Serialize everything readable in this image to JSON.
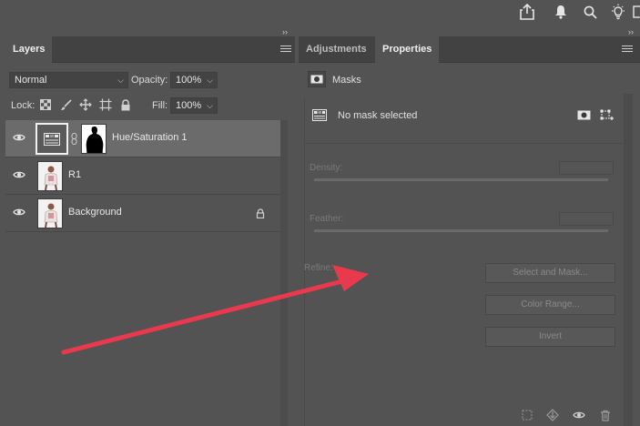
{
  "topbar": {
    "icons": [
      "share-icon",
      "bell-icon",
      "search-icon",
      "lightbulb-icon",
      "panel-icon"
    ]
  },
  "layers_panel": {
    "tab_label": "Layers",
    "blend_mode": "Normal",
    "opacity_label": "Opacity:",
    "opacity_value": "100%",
    "lock_label": "Lock:",
    "fill_label": "Fill:",
    "fill_value": "100%",
    "layers": [
      {
        "name": "Hue/Saturation 1",
        "type": "adjustment",
        "selected": true
      },
      {
        "name": "R1",
        "type": "image",
        "selected": false
      },
      {
        "name": "Background",
        "type": "image",
        "selected": false,
        "locked": true
      }
    ]
  },
  "properties_panel": {
    "tabs": [
      "Adjustments",
      "Properties"
    ],
    "active_tab": "Properties",
    "section_label": "Masks",
    "mask_status": "No mask selected",
    "density_label": "Density:",
    "feather_label": "Feather:",
    "refine_label": "Refine:",
    "buttons": {
      "select_and_mask": "Select and Mask...",
      "color_range": "Color Range...",
      "invert": "Invert"
    }
  },
  "colors": {
    "panel_bg": "#535353",
    "tab_bg": "#424242",
    "selected_row": "#6b6b6b",
    "annotation_arrow": "#e83a4c"
  }
}
